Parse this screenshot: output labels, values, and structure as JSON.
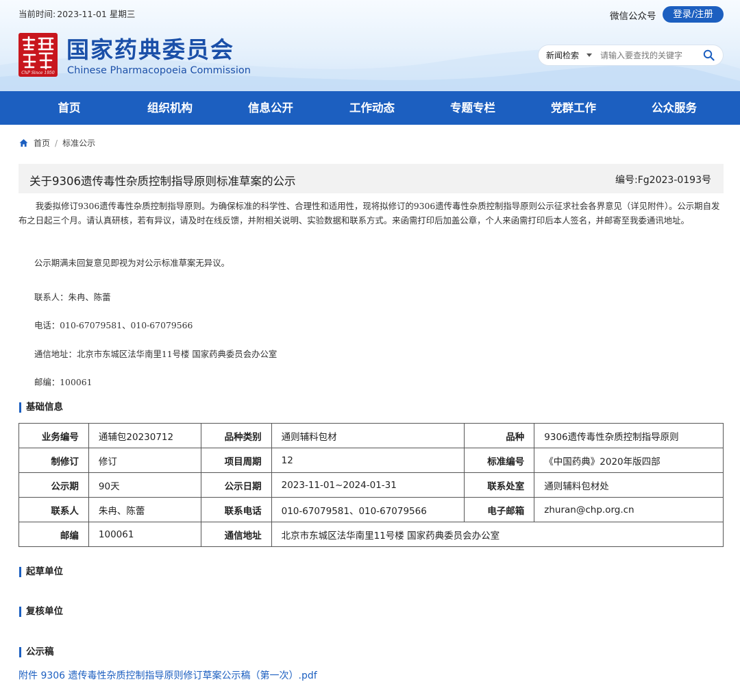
{
  "header": {
    "date_label": "当前时间:",
    "date_value": "2023-11-01 星期三",
    "wechat": "微信公众号",
    "login": "登录/注册",
    "logo_cn": "国家药典委员会",
    "logo_en": "Chinese Pharmacopoeia Commission",
    "logo_seal_text": "ChP Since 1950",
    "search": {
      "category": "新闻检索",
      "placeholder": "请输入要查找的关键字"
    }
  },
  "nav": [
    "首页",
    "组织机构",
    "信息公开",
    "工作动态",
    "专题专栏",
    "党群工作",
    "公众服务"
  ],
  "breadcrumb": {
    "home": "首页",
    "separator": "/",
    "current": "标准公示"
  },
  "notice": {
    "title": "关于9306遗传毒性杂质控制指导原则标准草案的公示",
    "number": "编号:Fg2023-0193号",
    "paragraph": "我委拟修订9306遗传毒性杂质控制指导原则。为确保标准的科学性、合理性和适用性，现将拟修订的9306遗传毒性杂质控制指导原则公示征求社会各界意见（详见附件）。公示期自发布之日起三个月。请认真研核，若有异议，请及时在线反馈，并附相关说明、实验数据和联系方式。来函需打印后加盖公章，个人来函需打印后本人签名，并邮寄至我委通讯地址。",
    "note": "公示期满未回复意见即视为对公示标准草案无异议。",
    "contact": "联系人：朱冉、陈蕾",
    "phone": "电话：010-67079581、010-67079566",
    "address": "通信地址：北京市东城区法华南里11号楼 国家药典委员会办公室",
    "postcode": "邮编：100061"
  },
  "sections": {
    "basic": "基础信息",
    "drafting": "起草单位",
    "review": "复核单位",
    "draft_doc": "公示稿"
  },
  "table": {
    "rows": [
      [
        "业务编号",
        "通辅包20230712",
        "品种类别",
        "通则辅料包材",
        "品种",
        "9306遗传毒性杂质控制指导原则"
      ],
      [
        "制修订",
        "修订",
        "项目周期",
        "12",
        "标准编号",
        "《中国药典》2020年版四部"
      ],
      [
        "公示期",
        "90天",
        "公示日期",
        "2023-11-01~2024-01-31",
        "联系处室",
        "通则辅料包材处"
      ],
      [
        "联系人",
        "朱冉、陈蕾",
        "联系电话",
        "010-67079581、010-67079566",
        "电子邮箱",
        "zhuran@chp.org.cn"
      ],
      [
        "邮编",
        "100061",
        "通信地址",
        "北京市东城区法华南里11号楼 国家药典委员会办公室"
      ]
    ]
  },
  "attachment": "附件 9306 遗传毒性杂质控制指导原则修订草案公示稿（第一次）.pdf",
  "colors": {
    "brand_blue": "#1c5fc0",
    "logo_red": "#c8161d",
    "title_bg": "#f2f2f2"
  }
}
